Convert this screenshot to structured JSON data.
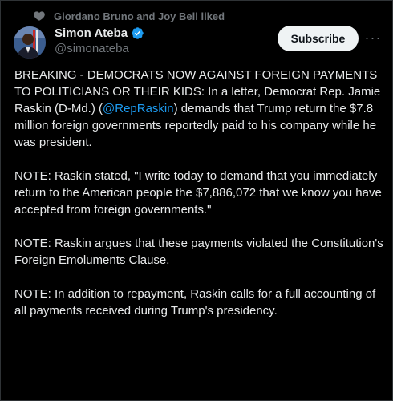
{
  "social_context": {
    "text": "Giordano Bruno and Joy Bell liked"
  },
  "author": {
    "display_name": "Simon Ateba",
    "handle": "@simonateba",
    "verified": true
  },
  "actions": {
    "subscribe_label": "Subscribe",
    "more_label": "···"
  },
  "colors": {
    "accent": "#1d9bf0",
    "background": "#000000",
    "text": "#e7e9ea",
    "muted": "#71767b"
  },
  "tweet": {
    "p1_before": "BREAKING - DEMOCRATS NOW AGAINST FOREIGN PAYMENTS TO POLITICIANS OR THEIR KIDS: In a letter, Democrat Rep. Jamie Raskin (D-Md.) (",
    "p1_mention": "@RepRaskin",
    "p1_after": ") demands that Trump return the $7.8 million foreign governments reportedly paid to his company while he was president.",
    "p2": "NOTE: Raskin stated, \"I write today to demand that you immediately return to the American people the $7,886,072 that we know you have accepted from foreign governments.\"",
    "p3": "NOTE: Raskin argues that these payments violated the Constitution's Foreign Emoluments Clause.",
    "p4": "NOTE: In addition to repayment, Raskin calls for a full accounting of all payments received during Trump's presidency."
  }
}
